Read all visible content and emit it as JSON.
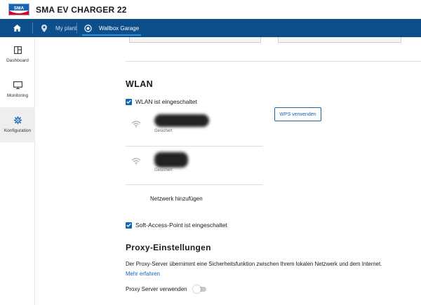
{
  "header": {
    "logo_text": "SMA",
    "app_title": "SMA EV CHARGER 22",
    "logo_color": "#e2001a"
  },
  "nav": {
    "home_icon": "home-icon",
    "items": [
      {
        "label": "My plant",
        "icon": "location-pin-icon"
      },
      {
        "label": "Wallbox Garage",
        "icon": "target-icon",
        "active": true
      }
    ],
    "bg_color": "#0c4f8a",
    "active_color": "#2d8fe0"
  },
  "sidebar": {
    "items": [
      {
        "label": "Dashboard",
        "icon": "dashboard-icon"
      },
      {
        "label": "Monitoring",
        "icon": "monitor-icon"
      },
      {
        "label": "Konfiguration",
        "icon": "gear-icon",
        "active": true
      }
    ]
  },
  "wlan": {
    "title": "WLAN",
    "enabled_label": "WLAN ist eingeschaltet",
    "enabled": true,
    "wps_button": "WPS verwenden",
    "networks": [
      {
        "status": "Gesichert",
        "icon": "wifi-icon"
      },
      {
        "status": "Gesichert",
        "icon": "wifi-icon"
      }
    ],
    "add_network": "Netzwerk hinzufügen",
    "softap_label": "Soft-Access-Point ist eingeschaltet",
    "softap_enabled": true
  },
  "proxy": {
    "title": "Proxy-Einstellungen",
    "description": "Der Proxy-Server übernimmt eine Sicherheitsfunktion zwischen Ihrem lokalen Netzwerk und dem Internet.",
    "more_link": "Mehr erfahren",
    "use_label": "Proxy Server verwenden",
    "use_enabled": false
  },
  "colors": {
    "accent": "#1465b4",
    "checkbox": "#1465b4"
  }
}
